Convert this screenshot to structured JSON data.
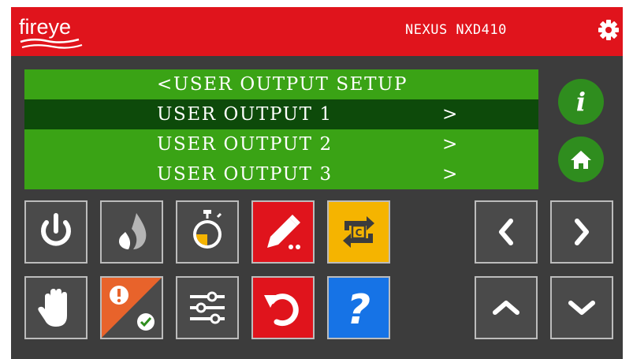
{
  "header": {
    "brand": "fireye",
    "model": "NEXUS NXD410",
    "settings_icon": "gear-icon"
  },
  "menu": {
    "title": "<USER OUTPUT SETUP",
    "items": [
      {
        "label": "USER OUTPUT 1",
        "arrow": ">",
        "selected": true
      },
      {
        "label": "USER OUTPUT 2",
        "arrow": ">",
        "selected": false
      },
      {
        "label": "USER OUTPUT 3",
        "arrow": ">",
        "selected": false
      }
    ]
  },
  "side_buttons": {
    "info_icon": "info-icon",
    "home_icon": "home-icon"
  },
  "function_buttons": [
    {
      "icon": "power-icon",
      "color": "#4a4a4a"
    },
    {
      "icon": "flame-icon",
      "color": "#4a4a4a"
    },
    {
      "icon": "timer-icon",
      "color": "#4a4a4a"
    },
    {
      "icon": "edit-icon",
      "color": "#e0141c"
    },
    {
      "icon": "cycle-icon",
      "color": "#f5b400"
    },
    {
      "icon": "hand-icon",
      "color": "#4a4a4a"
    },
    {
      "icon": "alarm-status-icon",
      "color": "#e8632b"
    },
    {
      "icon": "sliders-icon",
      "color": "#4a4a4a"
    },
    {
      "icon": "undo-icon",
      "color": "#e0141c"
    },
    {
      "icon": "help-icon",
      "color": "#1673e6"
    }
  ],
  "nav_buttons": [
    "left-arrow-icon",
    "right-arrow-icon",
    "up-arrow-icon",
    "down-arrow-icon"
  ],
  "colors": {
    "header_red": "#e0141c",
    "panel_bg": "#3c3c3c",
    "menu_green": "#3aa315",
    "menu_selected": "#0d4a0a",
    "circle_green": "#2f8d1e"
  }
}
